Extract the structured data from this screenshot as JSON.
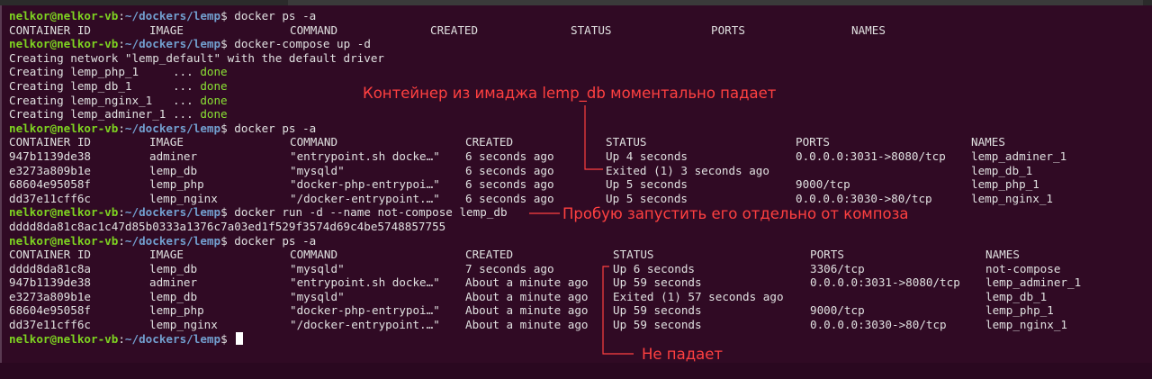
{
  "prompt": {
    "user": "nelkor@nelkor-vb",
    "path": "~/dockers/lemp",
    "sep": ":",
    "sign": "$"
  },
  "commands": {
    "ps1": "docker ps -a",
    "compose_up": "docker-compose up -d",
    "ps2": "docker ps -a",
    "run": "docker run -d --name not-compose lemp_db",
    "ps3": "docker ps -a"
  },
  "headers": [
    "CONTAINER ID",
    "IMAGE",
    "COMMAND",
    "CREATED",
    "STATUS",
    "PORTS",
    "NAMES"
  ],
  "compose_output": {
    "network": "Creating network \"lemp_default\" with the default driver",
    "creating": [
      {
        "name": "Creating lemp_php_1     ...",
        "status": "done"
      },
      {
        "name": "Creating lemp_db_1      ...",
        "status": "done"
      },
      {
        "name": "Creating lemp_nginx_1   ...",
        "status": "done"
      },
      {
        "name": "Creating lemp_adminer_1 ...",
        "status": "done"
      }
    ]
  },
  "table2": [
    [
      "947b1139de38",
      "adminer",
      "\"entrypoint.sh docke…\"",
      "6 seconds ago",
      "Up 4 seconds",
      "0.0.0.0:3031->8080/tcp",
      "lemp_adminer_1"
    ],
    [
      "e3273a809b1e",
      "lemp_db",
      "\"mysqld\"",
      "6 seconds ago",
      "Exited (1) 3 seconds ago",
      "",
      "lemp_db_1"
    ],
    [
      "68604e95058f",
      "lemp_php",
      "\"docker-php-entrypoi…\"",
      "6 seconds ago",
      "Up 5 seconds",
      "9000/tcp",
      "lemp_php_1"
    ],
    [
      "dd37e11cff6c",
      "lemp_nginx",
      "\"/docker-entrypoint.…\"",
      "6 seconds ago",
      "Up 5 seconds",
      "0.0.0.0:3030->80/tcp",
      "lemp_nginx_1"
    ]
  ],
  "run_output": "dddd8da81c8ac1c47d85b0333a1376c7a03ed1f529f3574d69c4be5748857755",
  "table3": [
    [
      "dddd8da81c8a",
      "lemp_db",
      "\"mysqld\"",
      "7 seconds ago",
      "Up 6 seconds",
      "3306/tcp",
      "not-compose"
    ],
    [
      "947b1139de38",
      "adminer",
      "\"entrypoint.sh docke…\"",
      "About a minute ago",
      "Up 59 seconds",
      "0.0.0.0:3031->8080/tcp",
      "lemp_adminer_1"
    ],
    [
      "e3273a809b1e",
      "lemp_db",
      "\"mysqld\"",
      "About a minute ago",
      "Exited (1) 57 seconds ago",
      "",
      "lemp_db_1"
    ],
    [
      "68604e95058f",
      "lemp_php",
      "\"docker-php-entrypoi…\"",
      "About a minute ago",
      "Up 59 seconds",
      "9000/tcp",
      "lemp_php_1"
    ],
    [
      "dd37e11cff6c",
      "lemp_nginx",
      "\"/docker-entrypoint.…\"",
      "About a minute ago",
      "Up 59 seconds",
      "0.0.0.0:3030->80/tcp",
      "lemp_nginx_1"
    ]
  ],
  "annotations": {
    "crash": "Контейнер из имаджа lemp_db моментально падает",
    "try_run": "Пробую запустить его отдельно от композа",
    "no_crash": "Не падает"
  },
  "colors": {
    "background": "#300a24",
    "user": "#7ed321",
    "path": "#729fcf",
    "done": "#8ae234",
    "annotation": "#ff4040"
  }
}
